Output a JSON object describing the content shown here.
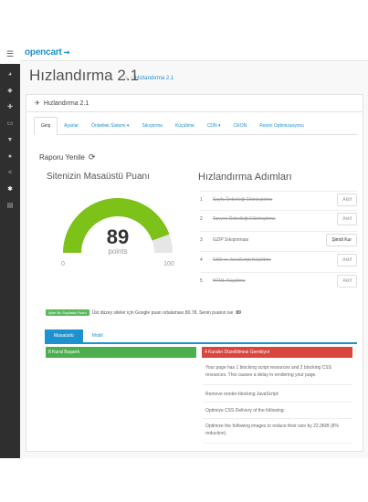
{
  "header": {
    "logo": "opencart",
    "logo_cart": "🛒"
  },
  "sidebar": {
    "items": [
      "dashboard",
      "tags",
      "puzzle",
      "desktop",
      "cart",
      "user",
      "share",
      "cog",
      "chart"
    ]
  },
  "page": {
    "title": "Hızlandırma 2.1",
    "breadcrumb": "Hızlandırma 2.1"
  },
  "panel": {
    "heading": "Hızlandırma 2.1",
    "tabs": [
      "Giriş",
      "Ayarlar",
      "Önbellek Sistemi ▾",
      "Sıkıştırma",
      "Küçültme",
      "CDN ▾",
      "CRON",
      "Resmi Optimizasyonu"
    ],
    "refresh": "Raporu Yenile",
    "speed_title": "Sitenizin Masaüstü Puanı",
    "score": "89",
    "score_label": "points",
    "score_min": "0",
    "score_max": "100",
    "score_fraction": 0.89,
    "steps_title": "Hızlandırma Adımları",
    "steps": [
      {
        "n": "1",
        "label": "Sayfa Önbelleği Etkinleştirme",
        "btn": "Aktif",
        "done": true
      },
      {
        "n": "2",
        "label": "Tarıyıcı Önbelleği Etkinleştirme",
        "btn": "Aktif",
        "done": true
      },
      {
        "n": "3",
        "label": "GZIP Sıkıştırması",
        "btn": "Şimdi Kur",
        "done": false
      },
      {
        "n": "4",
        "label": "CSS ve JavaScript Küçültme",
        "btn": "Aktif",
        "done": true
      },
      {
        "n": "5",
        "label": "HTML Küçültme",
        "btn": "Aktif",
        "done": true
      }
    ],
    "note_badge": "İyiler Bu Sayfada Puanı",
    "note_text": "Üst düzey siteler için Google puan ortalaması 80.78. Senin puanın ise",
    "note_score": "89",
    "subtabs": [
      "Masaüstü",
      "Mobil"
    ],
    "rule_ok": "8 Kural Başarılı",
    "rule_fix": "4 Kuralın Düzeltilmesi Gerekiyor",
    "issues": [
      "Your page has 1 blocking script resources and 2 blocking CSS resources. This causes a delay in rendering your page.",
      "Remove render-blocking JavaScript:",
      "Optimize CSS Delivery of the following:",
      "Optimize the following images to reduce their size by 22.3KiB (8% reduction)."
    ]
  }
}
